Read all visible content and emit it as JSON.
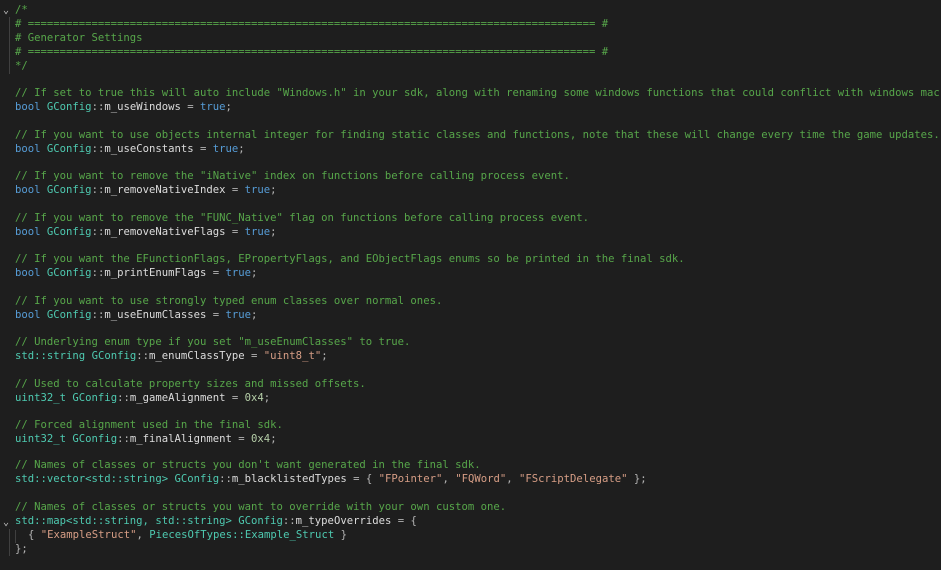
{
  "editor": {
    "header_comment": {
      "open": "/*",
      "rule1": "# ========================================================================================= #",
      "title": "# Generator Settings",
      "rule2": "# ========================================================================================= #",
      "close": "*/"
    },
    "settings": [
      {
        "comment": "// If set to true this will auto include \"Windows.h\" in your sdk, along with renaming some windows functions that could conflict with windows macros.",
        "type": "bool",
        "cls": "GConfig",
        "member": "m_useWindows",
        "value": "true",
        "value_kind": "kw"
      },
      {
        "comment": "// If you want to use objects internal integer for finding static classes and functions, note that these will change every time the game updates.",
        "type": "bool",
        "cls": "GConfig",
        "member": "m_useConstants",
        "value": "true",
        "value_kind": "kw"
      },
      {
        "comment": "// If you want to remove the \"iNative\" index on functions before calling process event.",
        "type": "bool",
        "cls": "GConfig",
        "member": "m_removeNativeIndex",
        "value": "true",
        "value_kind": "kw"
      },
      {
        "comment": "// If you want to remove the \"FUNC_Native\" flag on functions before calling process event.",
        "type": "bool",
        "cls": "GConfig",
        "member": "m_removeNativeFlags",
        "value": "true",
        "value_kind": "kw"
      },
      {
        "comment": "// If you want the EFunctionFlags, EPropertyFlags, and EObjectFlags enums so be printed in the final sdk.",
        "type": "bool",
        "cls": "GConfig",
        "member": "m_printEnumFlags",
        "value": "true",
        "value_kind": "kw"
      },
      {
        "comment": "// If you want to use strongly typed enum classes over normal ones.",
        "type": "bool",
        "cls": "GConfig",
        "member": "m_useEnumClasses",
        "value": "true",
        "value_kind": "kw"
      },
      {
        "comment": "// Underlying enum type if you set \"m_useEnumClasses\" to true.",
        "type": "std::string",
        "cls": "GConfig",
        "member": "m_enumClassType",
        "value": "\"uint8_t\"",
        "value_kind": "str"
      },
      {
        "comment": "// Used to calculate property sizes and missed offsets.",
        "type": "uint32_t",
        "cls": "GConfig",
        "member": "m_gameAlignment",
        "value": "0x4",
        "value_kind": "num"
      },
      {
        "comment": "// Forced alignment used in the final sdk.",
        "type": "uint32_t",
        "cls": "GConfig",
        "member": "m_finalAlignment",
        "value": "0x4",
        "value_kind": "num"
      }
    ],
    "blacklist": {
      "comment": "// Names of classes or structs you don't want generated in the final sdk.",
      "decl_type": "std::vector<std::string>",
      "cls": "GConfig",
      "member": "m_blacklistedTypes",
      "items": [
        "\"FPointer\"",
        "\"FQWord\"",
        "\"FScriptDelegate\""
      ]
    },
    "overrides": {
      "comment": "// Names of classes or structs you want to override with your own custom one.",
      "decl_type": "std::map<std::string, std::string>",
      "cls": "GConfig",
      "member": "m_typeOverrides",
      "entry_key": "\"ExampleStruct\"",
      "entry_value": "PiecesOfTypes::Example_Struct",
      "close": "};"
    },
    "fold_icon": "chevron-down-icon"
  }
}
